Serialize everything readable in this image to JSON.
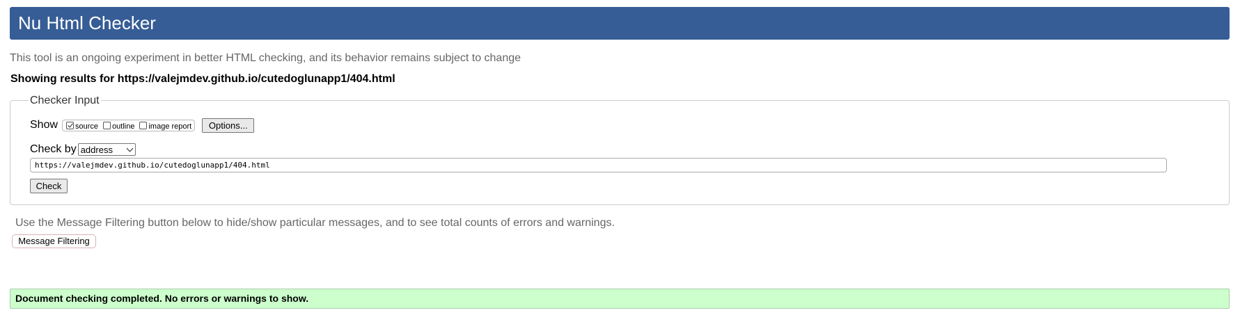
{
  "header": {
    "title": "Nu Html Checker"
  },
  "intro_text": "This tool is an ongoing experiment in better HTML checking, and its behavior remains subject to change",
  "results_for": "Showing results for https://valejmdev.github.io/cutedoglunapp1/404.html",
  "checker_input": {
    "legend": "Checker Input",
    "show_label": "Show",
    "show_options": [
      {
        "label": "source",
        "checked": true
      },
      {
        "label": "outline",
        "checked": false
      },
      {
        "label": "image report",
        "checked": false
      }
    ],
    "options_button": "Options...",
    "check_by_label": "Check by",
    "check_by_value": "address",
    "url_value": "https://valejmdev.github.io/cutedoglunapp1/404.html",
    "check_button": "Check"
  },
  "filtering": {
    "text": "Use the Message Filtering button below to hide/show particular messages, and to see total counts of errors and warnings.",
    "button": "Message Filtering"
  },
  "status": {
    "message": "Document checking completed. No errors or warnings to show."
  },
  "colors": {
    "header_bg": "#365d95",
    "success_bg": "#ccffcc"
  }
}
